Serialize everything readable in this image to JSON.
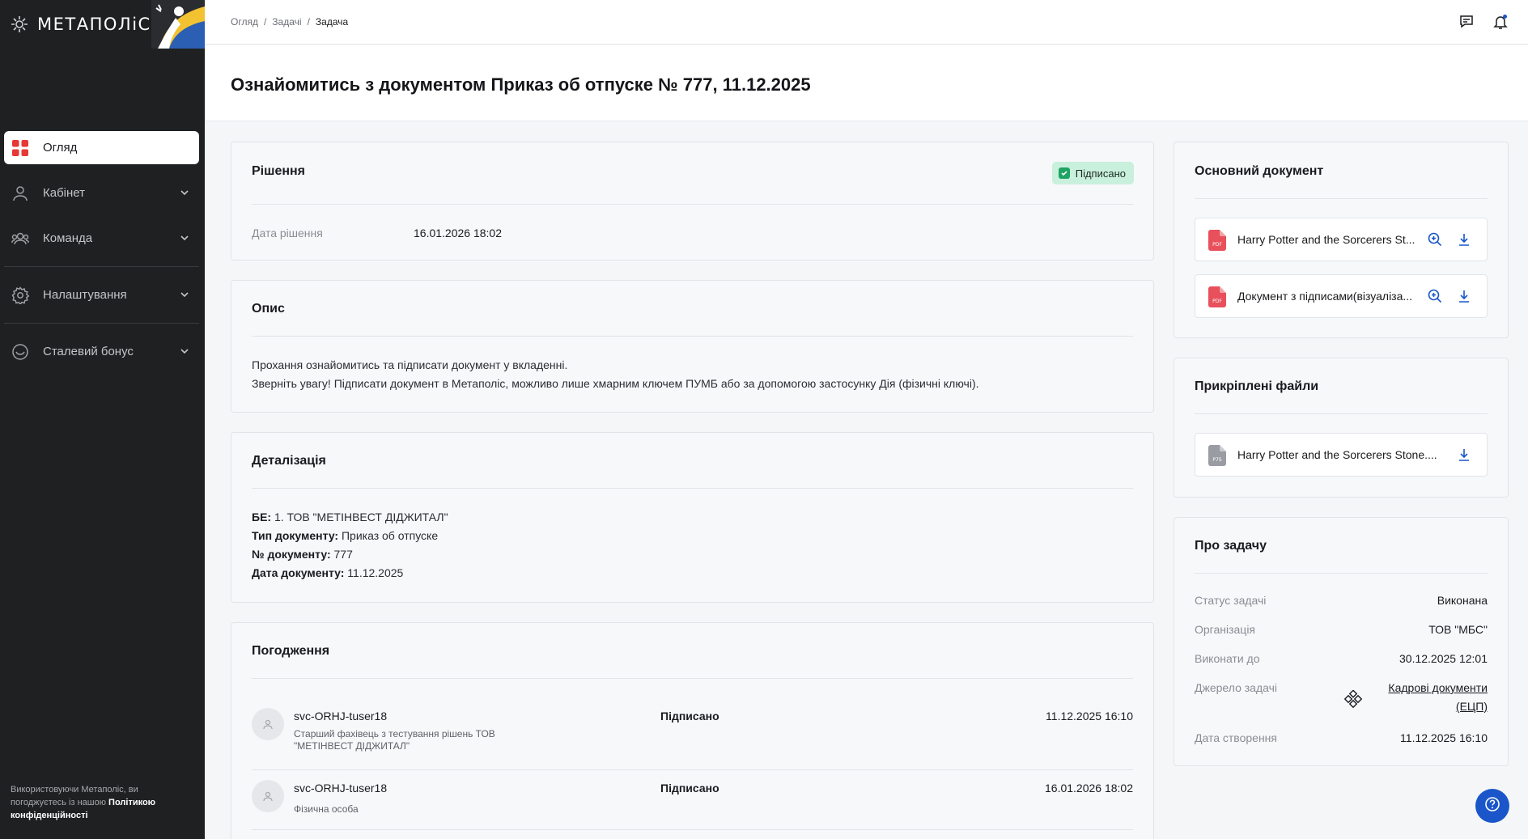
{
  "app": {
    "logo_text": "МЕТАПОЛіС"
  },
  "sidebar": {
    "items": [
      {
        "label": "Огляд",
        "icon": "dashboard-icon",
        "active": true
      },
      {
        "label": "Кабінет",
        "icon": "user-icon"
      },
      {
        "label": "Команда",
        "icon": "team-icon"
      },
      {
        "label": "Налаштування",
        "icon": "gear-icon"
      },
      {
        "label": "Сталевий бонус",
        "icon": "bonus-icon"
      }
    ],
    "footer_text": "Використовуючи Метаполіс, ви погоджуєтесь із нашою ",
    "footer_link": "Політикою конфіденційності"
  },
  "breadcrumb": {
    "items": [
      "Огляд",
      "Задачі"
    ],
    "current": "Задача",
    "separator": "/"
  },
  "page": {
    "title": "Ознайомитись з документом Приказ об отпуске № 777, 11.12.2025"
  },
  "decision": {
    "title": "Рішення",
    "badge": "Підписано",
    "date_label": "Дата рішення",
    "date_value": "16.01.2026 18:02"
  },
  "description": {
    "title": "Опис",
    "lines": [
      "Прохання ознайомитись та підписати документ у вкладенні.",
      "Зверніть увагу! Підписати документ в Метаполіс, можливо лише хмарним ключем ПУМБ або за допомогою застосунку Дія (фізичні ключі)."
    ]
  },
  "details": {
    "title": "Деталізація",
    "rows": [
      {
        "label": "БЕ:",
        "value": " 1. ТОВ \"МЕТІНВЕСТ ДІДЖИТАЛ\""
      },
      {
        "label": "Тип документу:",
        "value": " Приказ об отпуске"
      },
      {
        "label": "№ документу:",
        "value": " 777"
      },
      {
        "label": "Дата документу:",
        "value": " 11.12.2025"
      }
    ]
  },
  "approvals": {
    "title": "Погодження",
    "rows": [
      {
        "name": "svc-ORHJ-tuser18",
        "position": "Старший фахівець з тестування рішень ТОВ \"МЕТІНВЕСТ ДІДЖИТАЛ\"",
        "status": "Підписано",
        "date": "11.12.2025 16:10"
      },
      {
        "name": "svc-ORHJ-tuser18",
        "position": "Фізична особа",
        "status": "Підписано",
        "date": "16.01.2026 18:02"
      }
    ]
  },
  "main_document": {
    "title": "Основний документ",
    "files": [
      {
        "name": "Harry Potter and the Sorcerers St...",
        "type": "PDF"
      },
      {
        "name": "Документ з підписами(візуаліза...",
        "type": "PDF"
      }
    ]
  },
  "attachments": {
    "title": "Прикріплені файли",
    "files": [
      {
        "name": "Harry Potter and the Sorcerers Stone....",
        "type": "P7S"
      }
    ]
  },
  "about": {
    "title": "Про задачу",
    "status_label": "Статус задачі",
    "status_value": "Виконана",
    "org_label": "Організація",
    "org_value": "ТОВ \"МБС\"",
    "due_label": "Виконати до",
    "due_value": "30.12.2025 12:01",
    "source_label": "Джерело задачі",
    "source_value": "Кадрові документи (ЕЦП)",
    "created_label": "Дата створення",
    "created_value": "11.12.2025 16:10"
  },
  "colors": {
    "accent": "#1a56c9",
    "success_bg": "#c9f0dc",
    "success": "#1fa463",
    "sidebar_bg": "#1f2022",
    "pdf": "#e8505b"
  }
}
